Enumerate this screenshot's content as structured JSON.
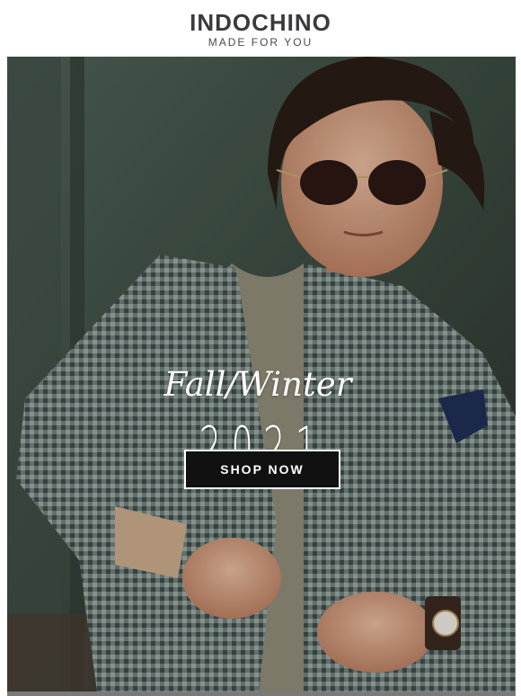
{
  "header": {
    "brand": "INDOCHINO",
    "tagline": "MADE FOR YOU"
  },
  "hero": {
    "season": "Fall/Winter",
    "year": "2021",
    "cta_label": "SHOP NOW",
    "photo_description_icon": "model-in-houndstooth-blazer-image"
  },
  "colors": {
    "brand_text": "#3a3a3c",
    "button_bg": "#111111",
    "button_border": "#ffffff"
  }
}
